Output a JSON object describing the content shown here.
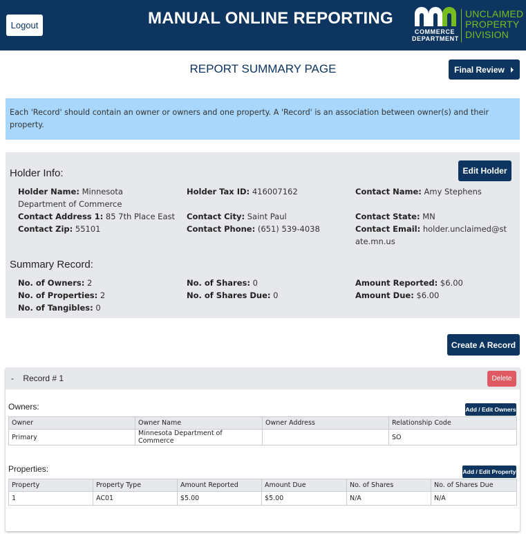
{
  "header": {
    "logout_label": "Logout",
    "app_title": "MANUAL ONLINE REPORTING",
    "logo": {
      "mark": "mn",
      "dept_line1": "COMMERCE",
      "dept_line2": "DEPARTMENT",
      "division_line1": "UNCLAIMED",
      "division_line2": "PROPERTY",
      "division_line3": "DIVISION"
    }
  },
  "page": {
    "title": "REPORT SUMMARY PAGE",
    "final_review_label": "Final Review"
  },
  "info_banner": "Each 'Record' should contain an owner or owners and one property. A 'Record' is an association between owner(s) and their property.",
  "holder": {
    "heading": "Holder Info:",
    "edit_label": "Edit Holder",
    "fields": {
      "name": {
        "label": "Holder Name:",
        "value": "Minnesota Department of Commerce"
      },
      "tax_id": {
        "label": "Holder Tax ID:",
        "value": "416007162"
      },
      "contact_name": {
        "label": "Contact Name:",
        "value": "Amy Stephens"
      },
      "address1": {
        "label": "Contact Address 1:",
        "value": "85 7th Place East"
      },
      "city": {
        "label": "Contact City:",
        "value": "Saint Paul"
      },
      "state": {
        "label": "Contact State:",
        "value": "MN"
      },
      "zip": {
        "label": "Contact Zip:",
        "value": "55101"
      },
      "phone": {
        "label": "Contact Phone:",
        "value": "(651) 539-4038"
      },
      "email": {
        "label": "Contact Email:",
        "value": "holder.unclaimed@state.mn.us"
      }
    }
  },
  "summary": {
    "heading": "Summary Record:",
    "fields": {
      "owners": {
        "label": "No. of Owners:",
        "value": "2"
      },
      "properties": {
        "label": "No. of Properties:",
        "value": "2"
      },
      "tangibles": {
        "label": "No. of Tangibles:",
        "value": "0"
      },
      "shares": {
        "label": "No. of Shares:",
        "value": "0"
      },
      "shares_due": {
        "label": "No. of Shares Due:",
        "value": "0"
      },
      "amount_reported": {
        "label": "Amount Reported:",
        "value": "$6.00"
      },
      "amount_due": {
        "label": "Amount Due:",
        "value": "$6.00"
      }
    }
  },
  "create_record_label": "Create A Record",
  "record": {
    "toggle": "-",
    "title": "Record # 1",
    "delete_label": "Delete",
    "owners": {
      "heading": "Owners:",
      "edit_label": "Add / Edit Owners",
      "columns": [
        "Owner",
        "Owner Name",
        "Owner Address",
        "Relationship Code"
      ],
      "rows": [
        [
          "Primary",
          "Minnesota Department of Commerce",
          "",
          "SO"
        ]
      ]
    },
    "properties": {
      "heading": "Properties:",
      "edit_label": "Add / Edit Property",
      "columns": [
        "Property",
        "Property Type",
        "Amount Reported",
        "Amount Due",
        "No. of Shares",
        "No. of Shares Due"
      ],
      "rows": [
        [
          "1",
          "AC01",
          "$5.00",
          "$5.00",
          "N/A",
          "N/A"
        ]
      ]
    }
  },
  "colors": {
    "navy": "#0d3560",
    "logo_green": "#78be20",
    "banner_blue": "#a8d7fb",
    "panel_gray": "#e6e8eb",
    "delete_red": "#e05a63"
  }
}
